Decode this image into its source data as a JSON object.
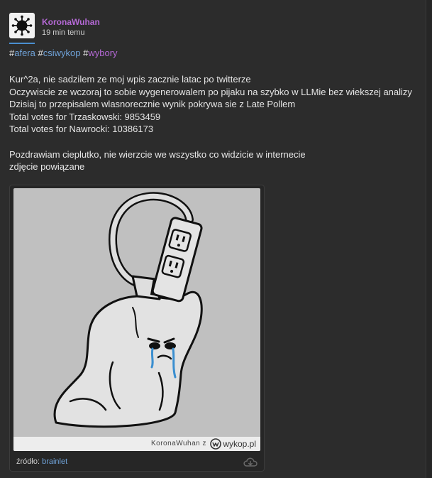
{
  "post": {
    "author": "KoronaWuhan",
    "time": "19 min temu",
    "tags": [
      {
        "hash": "#",
        "name": "afera"
      },
      {
        "hash": "#",
        "name": "csiwykop"
      },
      {
        "hash": "#",
        "name": "wybory"
      }
    ],
    "lines": [
      "Kur^2a, nie sadzilem ze moj wpis zacznie latac po twitterze",
      "Oczywiscie ze wczoraj to sobie wygenerowalem po pijaku na szybko w LLMie bez wiekszej analizy",
      "Dzisiaj to przepisalem wlasnorecznie wynik pokrywa sie z Late Pollem",
      "Total votes for Trzaskowski: 9853459",
      "Total votes for Nawrocki: 10386173"
    ],
    "lines2": [
      "Pozdrawiam cieplutko, nie wierzcie we wszystko co widzicie w internecie",
      "zdjęcie powiązane"
    ]
  },
  "embed": {
    "watermark_author": "KoronaWuhan",
    "watermark_z": "z",
    "watermark_site": "wykop.pl",
    "source_label": "źródło:",
    "source_link": "brainlet"
  },
  "colors": {
    "background": "#2c2c2c",
    "username": "#b569d6",
    "tag_blue": "#6fa2d8",
    "tag_purple": "#b569d6"
  },
  "icons": [
    "virus-avatar-icon",
    "cloud-download-icon",
    "wykop-logo-icon"
  ]
}
